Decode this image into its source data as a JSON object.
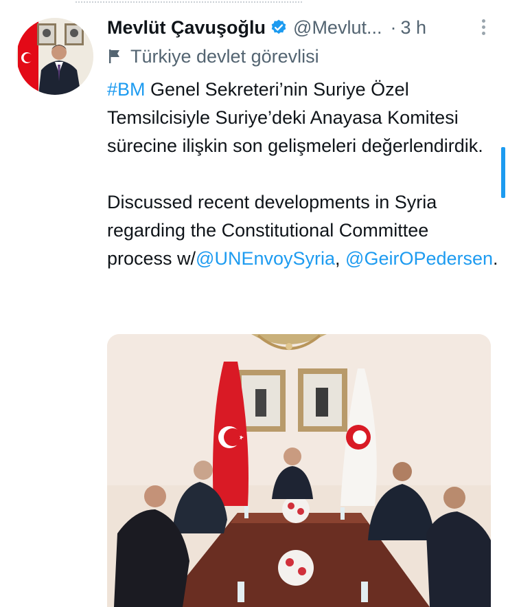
{
  "tweet": {
    "author_name": "Mevlüt Çavuşoğlu",
    "handle": "@Mevlut...",
    "separator": "·",
    "time": "3 h",
    "label": "Türkiye devlet görevlisi",
    "body": {
      "hashtag": "#BM",
      "tr_text": " Genel Sekreteri’nin Suriye Özel Temsilcisiyle Suriye’deki Anayasa Komitesi sürecine ilişkin son gelişmeleri değerlendirdik.",
      "en_text": "Discussed recent developments in Syria regarding the Constitutional Committee process w/",
      "mention1": "@UNEnvoySyria",
      "comma": ",",
      "mention2": "@GeirOPedersen",
      "period": "."
    }
  },
  "icons": {
    "verified": "verified-badge-icon",
    "label": "flag-icon",
    "more": "more-options-icon"
  },
  "colors": {
    "link": "#1d9bf0",
    "secondary_text": "#536471",
    "primary_text": "#0f1419"
  }
}
